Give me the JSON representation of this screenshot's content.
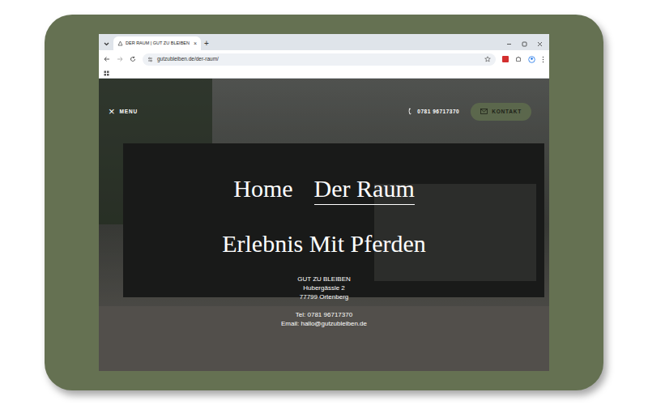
{
  "browser": {
    "tab_title": "DER RAUM | GUT ZU BLEIBEN",
    "tab_close": "×",
    "new_tab": "+",
    "url": "gutzubleiben.de/der-raum/"
  },
  "header": {
    "close_icon": "×",
    "menu": "MENU",
    "phone": "0781 96717370",
    "contact": "KONTAKT"
  },
  "nav": [
    {
      "label": "Home",
      "selected": false
    },
    {
      "label": "Der Raum",
      "selected": true
    }
  ],
  "heading": "Erlebnis Mit Pferden",
  "address": {
    "name": "GUT ZU BLEIBEN",
    "street": "Hubergässle 2",
    "city": "77799 Ortenberg",
    "phone": "Tel: 0781 96717370",
    "email": "Email: hallo@gutzubleiben.de"
  },
  "scrollbar": {
    "level": 0.12
  }
}
